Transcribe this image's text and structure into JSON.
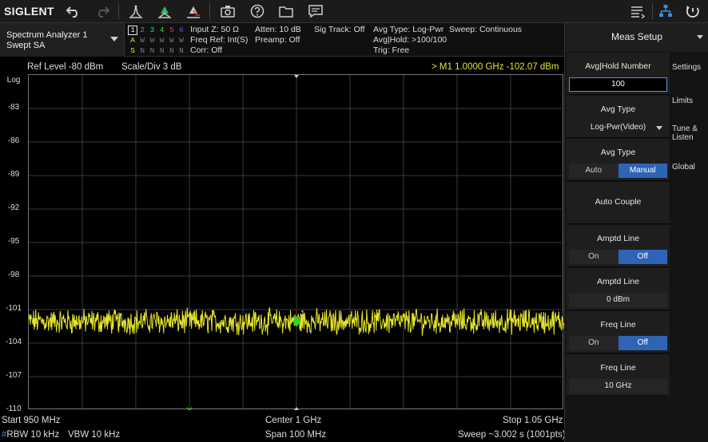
{
  "toolbar": {
    "logo": "SIGLENT",
    "buttons": [
      "undo-icon",
      "redo-icon",
      "peak-search-icon",
      "marker-icon",
      "marker-delta-icon",
      "camera-icon",
      "help-icon",
      "folder-icon",
      "message-icon",
      "menu-list-icon",
      "network-icon",
      "reset-icon"
    ]
  },
  "mode": {
    "line1": "Spectrum Analyzer 1",
    "line2": "Swept SA"
  },
  "traces": {
    "numbers": [
      "1",
      "2",
      "3",
      "4",
      "5",
      "6"
    ],
    "number_colors": [
      "#e8e8e8",
      "#d050d0",
      "#40c0e0",
      "#40d040",
      "#e04040",
      "#4060e0"
    ],
    "types": [
      "A",
      "W",
      "W",
      "W",
      "W",
      "W"
    ],
    "detectors": [
      "S",
      "N",
      "N",
      "N",
      "N",
      "N"
    ]
  },
  "info": {
    "col1": [
      "Input Z: 50 Ω",
      "Freq Ref: Int(S)",
      "Corr: Off"
    ],
    "col2": [
      "Atten: 10 dB",
      "Preamp: Off"
    ],
    "col3": [
      "Sig Track: Off"
    ],
    "col4": [
      "Avg Type: Log-Pwr",
      "Avg|Hold: >100/100",
      "Trig: Free"
    ],
    "col5": [
      "Sweep: Continuous"
    ]
  },
  "plot": {
    "ref_level": "Ref Level  -80 dBm",
    "scale": "Scale/Div  3 dB",
    "marker_readout": "> M1   1.0000 GHz  -102.07 dBm",
    "log_label": "Log",
    "y_ticks": [
      "-83",
      "-86",
      "-89",
      "-92",
      "-95",
      "-98",
      "-101",
      "-104",
      "-107",
      "-110"
    ],
    "start": "Start  950 MHz",
    "center": "Center  1 GHz",
    "stop": "Stop  1.05 GHz",
    "rbw_prefix": "#",
    "rbw": "RBW  10 kHz",
    "vbw": "VBW  10 kHz",
    "span": "Span  100 MHz",
    "sweep": "Sweep  ~3.002 s (1001pts)",
    "marker_label": "1",
    "trace_color": "#e6e62a",
    "marker_color": "#22dd22"
  },
  "chart_data": {
    "type": "line",
    "x_range_mhz": [
      950,
      1050
    ],
    "y_range_dbm": [
      -110,
      -80
    ],
    "grid": true,
    "series": [
      {
        "noise_floor_dbm": -102.07,
        "points": 1001
      }
    ],
    "marker": {
      "label": "1",
      "x_mhz": 1000,
      "y_dbm": -102.07
    }
  },
  "panel": {
    "title": "Meas Setup",
    "softkeys": [
      {
        "label": "Avg|Hold Number",
        "value": "100",
        "kind": "input"
      },
      {
        "label": "Avg Type",
        "value": "Log-Pwr(Video)",
        "kind": "dropdown"
      },
      {
        "label": "Avg Type",
        "options": [
          "Auto",
          "Manual"
        ],
        "selected": 1,
        "kind": "toggle"
      },
      {
        "label": "Auto Couple",
        "kind": "action"
      },
      {
        "label": "Amptd Line",
        "options": [
          "On",
          "Off"
        ],
        "selected": 1,
        "kind": "toggle"
      },
      {
        "label": "Amptd Line",
        "value": "0 dBm",
        "kind": "value"
      },
      {
        "label": "Freq Line",
        "options": [
          "On",
          "Off"
        ],
        "selected": 1,
        "kind": "toggle"
      },
      {
        "label": "Freq Line",
        "value": "10 GHz",
        "kind": "value"
      }
    ],
    "tabs": [
      "Settings",
      "Limits",
      "Tune & Listen",
      "Global"
    ]
  }
}
